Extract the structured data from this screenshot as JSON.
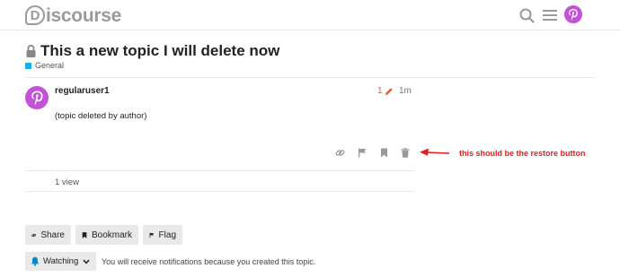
{
  "header": {
    "logo_text": "iscourse",
    "logo_letter": "D"
  },
  "topic": {
    "title": "This a new topic I will delete now",
    "category": "General",
    "category_color": "#25aae1"
  },
  "post": {
    "username": "regularuser1",
    "edit_count": "1",
    "age": "1m",
    "body": "(topic deleted by author)",
    "avatar_color": "#c252d6"
  },
  "annotation": {
    "text": "this should be the restore button",
    "color": "#e02020"
  },
  "stats": {
    "views": "1 view"
  },
  "footer": {
    "share_label": "Share",
    "bookmark_label": "Bookmark",
    "flag_label": "Flag",
    "watching_label": "Watching",
    "notification_text": "You will receive notifications because you created this topic."
  },
  "icons": [
    "search-icon",
    "hamburger-menu-icon",
    "lock-icon",
    "pencil-icon",
    "link-icon",
    "flag-icon",
    "bookmark-icon",
    "trash-icon",
    "bell-icon",
    "chevron-down-icon"
  ]
}
